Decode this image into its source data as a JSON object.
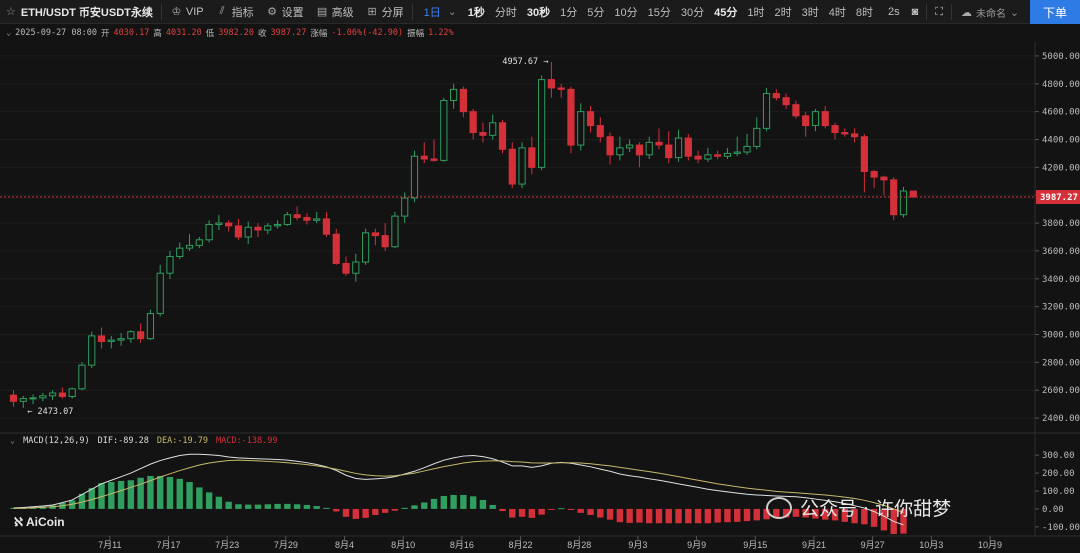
{
  "toolbar": {
    "symbol": "ETH/USDT 币安USDT永续",
    "vip": "VIP",
    "indicators": "指标",
    "settings": "设置",
    "advanced": "高级",
    "split": "分屏",
    "intervals": [
      "1日",
      "1秒",
      "分时",
      "30秒",
      "1分",
      "5分",
      "10分",
      "15分",
      "30分",
      "45分",
      "1时",
      "2时",
      "3时",
      "4时",
      "8时"
    ],
    "refresh": "2s",
    "layout_name": "未命名",
    "download": "下单"
  },
  "kline_info": {
    "datetime": "2025-09-27 08:00",
    "open_label": "开",
    "open": "4030.17",
    "high_label": "高",
    "high": "4031.20",
    "low_label": "低",
    "low": "3982.20",
    "close_label": "收",
    "close": "3987.27",
    "change_label": "涨幅",
    "change": "-1.06%(-42.90)",
    "amplitude_label": "振幅",
    "amplitude": "1.22%"
  },
  "macd_info": {
    "label": "MACD(12,26,9)",
    "dif": "DIF:-89.28",
    "dea": "DEA:-19.79",
    "macd": "MACD:-138.99"
  },
  "annotations": {
    "high_marker": "4957.67 →",
    "low_marker": "← 2473.07",
    "last_price": "3987.27"
  },
  "logo": "AiCoin",
  "watermark": "公众号 · 许你甜梦",
  "colors": {
    "up": "#2f9e5e",
    "down": "#d3303a",
    "accent": "#2f7be5",
    "dif_line": "#e0e0e0",
    "dea_line": "#c8b86a"
  },
  "chart_data": [
    {
      "type": "candlestick",
      "ylim": [
        2300,
        5100
      ],
      "y_ticks": [
        5000,
        4800,
        4600,
        4400,
        4200,
        4000,
        3800,
        3600,
        3400,
        3200,
        3000,
        2800,
        2600,
        2400
      ],
      "y_tick_labels": [
        "5000.00",
        "4800.00",
        "4600.00",
        "4400.00",
        "4200.00",
        "4000.00",
        "3800.00",
        "3600.00",
        "3400.00",
        "3200.00",
        "3000.00",
        "2800.00",
        "2600.00",
        "2400.00"
      ],
      "x_tick_labels": [
        "7月11",
        "7月17",
        "7月23",
        "7月29",
        "8月4",
        "8月10",
        "8月16",
        "8月22",
        "8月28",
        "9月3",
        "9月9",
        "9月15",
        "9月21",
        "9月27",
        "10月3",
        "10月9"
      ],
      "x_tick_index": [
        10,
        16,
        22,
        28,
        34,
        40,
        46,
        52,
        58,
        64,
        70,
        76,
        82,
        88,
        94,
        100
      ],
      "candles": [
        [
          2565,
          2600,
          2480,
          2520
        ],
        [
          2520,
          2560,
          2473,
          2540
        ],
        [
          2540,
          2570,
          2500,
          2545
        ],
        [
          2545,
          2580,
          2520,
          2560
        ],
        [
          2560,
          2600,
          2530,
          2580
        ],
        [
          2580,
          2620,
          2540,
          2555
        ],
        [
          2555,
          2620,
          2540,
          2610
        ],
        [
          2610,
          2800,
          2600,
          2780
        ],
        [
          2780,
          3020,
          2760,
          2990
        ],
        [
          2990,
          3050,
          2900,
          2950
        ],
        [
          2950,
          2990,
          2900,
          2960
        ],
        [
          2960,
          3010,
          2920,
          2970
        ],
        [
          2970,
          3030,
          2940,
          3020
        ],
        [
          3020,
          3080,
          2940,
          2970
        ],
        [
          2970,
          3180,
          2960,
          3150
        ],
        [
          3150,
          3500,
          3130,
          3440
        ],
        [
          3440,
          3600,
          3400,
          3560
        ],
        [
          3560,
          3660,
          3540,
          3620
        ],
        [
          3620,
          3720,
          3600,
          3640
        ],
        [
          3640,
          3700,
          3620,
          3680
        ],
        [
          3680,
          3820,
          3660,
          3790
        ],
        [
          3790,
          3860,
          3750,
          3800
        ],
        [
          3800,
          3820,
          3740,
          3780
        ],
        [
          3780,
          3830,
          3680,
          3700
        ],
        [
          3700,
          3810,
          3650,
          3770
        ],
        [
          3770,
          3800,
          3700,
          3750
        ],
        [
          3750,
          3800,
          3720,
          3780
        ],
        [
          3780,
          3820,
          3760,
          3790
        ],
        [
          3790,
          3880,
          3780,
          3860
        ],
        [
          3860,
          3920,
          3820,
          3840
        ],
        [
          3840,
          3870,
          3790,
          3820
        ],
        [
          3820,
          3880,
          3800,
          3830
        ],
        [
          3830,
          3880,
          3700,
          3720
        ],
        [
          3720,
          3760,
          3500,
          3510
        ],
        [
          3510,
          3560,
          3420,
          3440
        ],
        [
          3440,
          3580,
          3380,
          3520
        ],
        [
          3520,
          3760,
          3500,
          3730
        ],
        [
          3730,
          3760,
          3640,
          3710
        ],
        [
          3710,
          3800,
          3600,
          3630
        ],
        [
          3630,
          3880,
          3620,
          3850
        ],
        [
          3850,
          4020,
          3800,
          3980
        ],
        [
          3980,
          4320,
          3950,
          4280
        ],
        [
          4280,
          4380,
          4230,
          4260
        ],
        [
          4260,
          4400,
          4240,
          4250
        ],
        [
          4250,
          4700,
          4240,
          4680
        ],
        [
          4680,
          4800,
          4620,
          4760
        ],
        [
          4760,
          4780,
          4560,
          4600
        ],
        [
          4600,
          4620,
          4400,
          4450
        ],
        [
          4450,
          4520,
          4380,
          4430
        ],
        [
          4430,
          4580,
          4400,
          4520
        ],
        [
          4520,
          4540,
          4300,
          4330
        ],
        [
          4330,
          4380,
          4050,
          4080
        ],
        [
          4080,
          4380,
          4050,
          4340
        ],
        [
          4340,
          4420,
          4150,
          4200
        ],
        [
          4200,
          4860,
          4180,
          4830
        ],
        [
          4830,
          4957,
          4700,
          4770
        ],
        [
          4770,
          4800,
          4700,
          4760
        ],
        [
          4760,
          4780,
          4300,
          4360
        ],
        [
          4360,
          4660,
          4320,
          4600
        ],
        [
          4600,
          4640,
          4450,
          4500
        ],
        [
          4500,
          4560,
          4380,
          4420
        ],
        [
          4420,
          4450,
          4220,
          4290
        ],
        [
          4290,
          4420,
          4250,
          4340
        ],
        [
          4340,
          4400,
          4310,
          4360
        ],
        [
          4360,
          4380,
          4200,
          4290
        ],
        [
          4290,
          4420,
          4260,
          4380
        ],
        [
          4380,
          4480,
          4330,
          4360
        ],
        [
          4360,
          4460,
          4230,
          4270
        ],
        [
          4270,
          4470,
          4240,
          4410
        ],
        [
          4410,
          4440,
          4250,
          4280
        ],
        [
          4280,
          4320,
          4230,
          4260
        ],
        [
          4260,
          4340,
          4240,
          4290
        ],
        [
          4290,
          4320,
          4260,
          4280
        ],
        [
          4280,
          4340,
          4260,
          4300
        ],
        [
          4300,
          4420,
          4280,
          4310
        ],
        [
          4310,
          4440,
          4290,
          4350
        ],
        [
          4350,
          4560,
          4330,
          4480
        ],
        [
          4480,
          4770,
          4460,
          4730
        ],
        [
          4730,
          4760,
          4680,
          4700
        ],
        [
          4700,
          4730,
          4620,
          4650
        ],
        [
          4650,
          4680,
          4550,
          4570
        ],
        [
          4570,
          4600,
          4420,
          4500
        ],
        [
          4500,
          4620,
          4460,
          4600
        ],
        [
          4600,
          4640,
          4480,
          4500
        ],
        [
          4500,
          4520,
          4400,
          4450
        ],
        [
          4450,
          4480,
          4420,
          4440
        ],
        [
          4440,
          4480,
          4380,
          4420
        ],
        [
          4420,
          4440,
          4020,
          4170
        ],
        [
          4170,
          4180,
          4050,
          4130
        ],
        [
          4130,
          4140,
          4000,
          4110
        ],
        [
          4110,
          4130,
          3820,
          3860
        ],
        [
          3860,
          4060,
          3840,
          4030
        ],
        [
          4030,
          4031,
          3982,
          3987
        ]
      ]
    },
    {
      "type": "macd",
      "ylim": [
        -140,
        340
      ],
      "y_ticks": [
        300,
        200,
        100,
        0,
        -100
      ],
      "y_tick_labels": [
        "300.00",
        "200.00",
        "100.00",
        "0.00",
        "-100.00"
      ],
      "series": [
        {
          "name": "DIF",
          "values": [
            5,
            8,
            12,
            16,
            22,
            35,
            50,
            80,
            110,
            140,
            160,
            180,
            200,
            225,
            250,
            270,
            285,
            298,
            305,
            305,
            302,
            298,
            290,
            285,
            282,
            280,
            278,
            276,
            272,
            266,
            258,
            248,
            235,
            215,
            188,
            170,
            165,
            168,
            172,
            180,
            195,
            210,
            230,
            252,
            272,
            285,
            295,
            298,
            292,
            280,
            262,
            240,
            240,
            232,
            240,
            255,
            260,
            255,
            245,
            235,
            222,
            210,
            195,
            185,
            178,
            168,
            160,
            150,
            140,
            130,
            120,
            110,
            102,
            95,
            88,
            82,
            78,
            75,
            72,
            70,
            68,
            62,
            55,
            48,
            40,
            30,
            18,
            5,
            -15,
            -40,
            -70,
            -89
          ]
        },
        {
          "name": "DEA",
          "values": [
            2,
            4,
            6,
            9,
            12,
            18,
            26,
            38,
            52,
            68,
            85,
            102,
            120,
            138,
            158,
            178,
            196,
            214,
            230,
            245,
            256,
            264,
            270,
            272,
            270,
            268,
            265,
            262,
            258,
            253,
            247,
            240,
            232,
            222,
            210,
            198,
            190,
            185,
            183,
            185,
            192,
            200,
            212,
            224,
            236,
            246,
            256,
            263,
            267,
            269,
            268,
            264,
            262,
            257,
            256,
            256,
            258,
            258,
            256,
            252,
            246,
            240,
            232,
            224,
            216,
            208,
            200,
            190,
            180,
            170,
            160,
            150,
            140,
            132,
            124,
            116,
            110,
            104,
            98,
            94,
            90,
            86,
            82,
            78,
            72,
            66,
            58,
            48,
            35,
            20,
            0,
            -20
          ]
        }
      ],
      "histogram": [
        6,
        8,
        12,
        14,
        20,
        34,
        48,
        84,
        116,
        144,
        150,
        156,
        160,
        174,
        184,
        184,
        178,
        168,
        150,
        120,
        92,
        68,
        40,
        26,
        24,
        24,
        26,
        28,
        28,
        26,
        22,
        16,
        6,
        -14,
        -44,
        -56,
        -50,
        -34,
        -22,
        -10,
        6,
        20,
        36,
        56,
        72,
        78,
        78,
        70,
        50,
        22,
        -12,
        -48,
        -44,
        -50,
        -32,
        -2,
        4,
        -6,
        -22,
        -34,
        -48,
        -60,
        -74,
        -78,
        -76,
        -80,
        -80,
        -80,
        -80,
        -80,
        -80,
        -80,
        -76,
        -74,
        -72,
        -68,
        -64,
        -58,
        -52,
        -48,
        -44,
        -48,
        -54,
        -60,
        -64,
        -72,
        -80,
        -86,
        -100,
        -120,
        -140,
        -138
      ]
    }
  ]
}
